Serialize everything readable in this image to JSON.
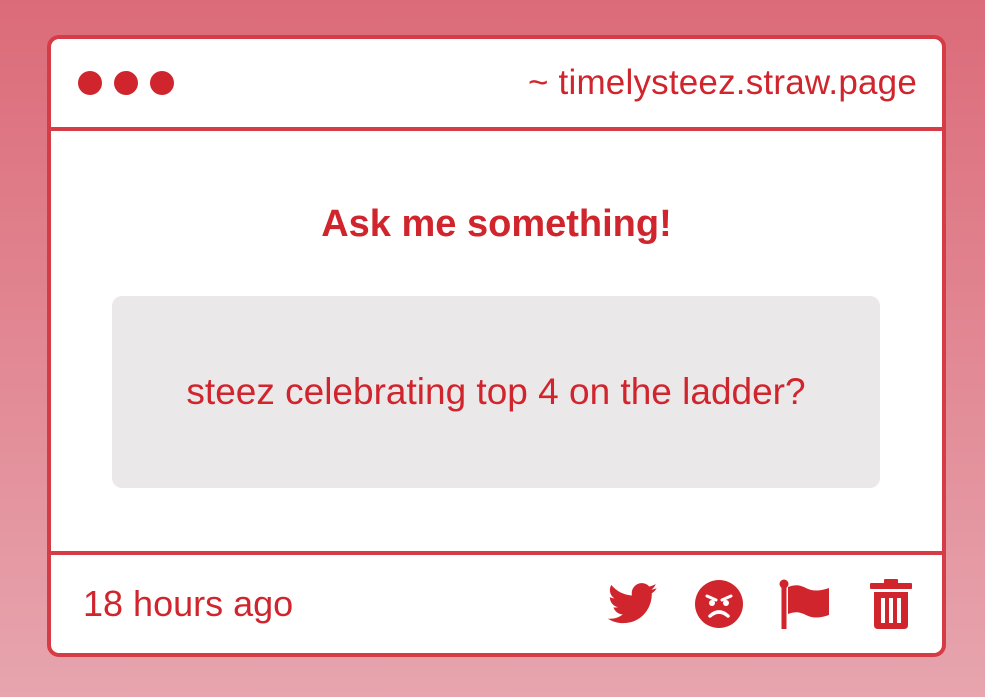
{
  "window": {
    "url": "~ timelysteez.straw.page"
  },
  "main": {
    "heading": "Ask me something!",
    "question": "steez celebrating top 4 on the ladder?"
  },
  "footer": {
    "timestamp": "18 hours ago",
    "actions": [
      {
        "icon": "twitter-bird-icon"
      },
      {
        "icon": "angry-face-icon"
      },
      {
        "icon": "flag-icon"
      },
      {
        "icon": "trash-icon"
      }
    ]
  },
  "colors": {
    "accent": "#d0252d",
    "border": "#d63c45",
    "question_bg": "#ebe8e9",
    "page_bg_top": "#dc6b79",
    "page_bg_bottom": "#e7a5ae"
  }
}
